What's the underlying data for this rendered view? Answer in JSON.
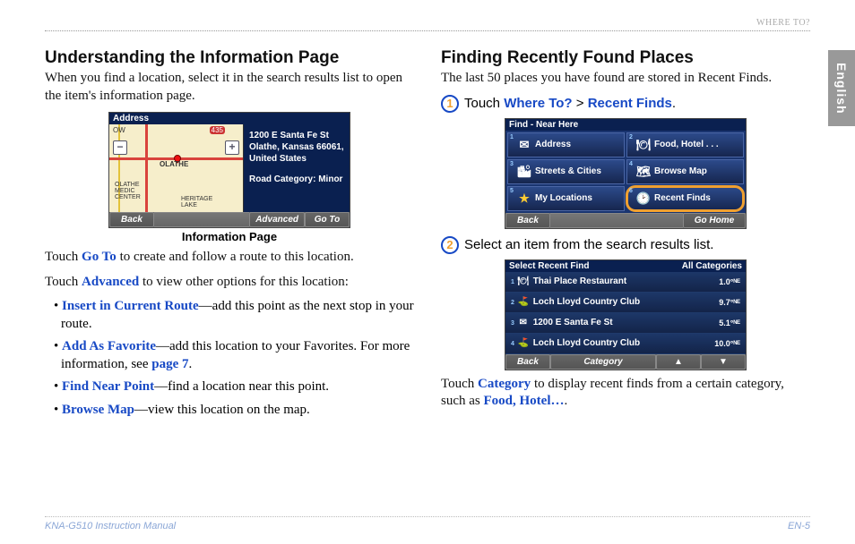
{
  "header": {
    "section": "WHERE TO?",
    "lang_tab": "English"
  },
  "col1": {
    "heading": "Understanding the Information Page",
    "intro": "When you find a location, select it in the search results list to open the item's information page.",
    "info_shot": {
      "title": "Address",
      "addr1": "1200 E Santa Fe St",
      "addr2": "Olathe, Kansas 66061,",
      "addr3": "United States",
      "road_cat": "Road Category: Minor",
      "back": "Back",
      "advanced": "Advanced",
      "goto": "Go To",
      "map_labels": {
        "ow": "OW",
        "olathe": "OLATHE",
        "medic": "OLATHE\nMEDIC\nCENTER",
        "lake": "HERITAGE\nLAKE",
        "hwy": "435"
      }
    },
    "caption": "Information Page",
    "p_goto_pre": "Touch ",
    "p_goto_link": "Go To",
    "p_goto_post": " to create and follow a route to this location.",
    "p_adv_pre": "Touch ",
    "p_adv_link": "Advanced",
    "p_adv_post": " to view other options for this location:",
    "opts": [
      {
        "b": "Insert in Current Route",
        "t": "—add this point as the next stop in your route."
      },
      {
        "b": "Add As Favorite",
        "t": "—add this location to your Favorites. For more information, see ",
        "pg": "page 7",
        "tail": "."
      },
      {
        "b": "Find Near Point",
        "t": "—find a location near this point."
      },
      {
        "b": "Browse Map",
        "t": "—view this location on the map."
      }
    ]
  },
  "col2": {
    "heading": "Finding Recently Found Places",
    "intro": "The last 50 places you have found are stored in Recent Finds.",
    "step1_pre": "Touch ",
    "step1_a": "Where To?",
    "step1_sep": " > ",
    "step1_b": "Recent Finds",
    "step1_post": ".",
    "find_shot": {
      "title": "Find - Near Here",
      "tiles": [
        {
          "n": "1",
          "icon": "✉",
          "label": "Address"
        },
        {
          "n": "2",
          "icon": "🍽",
          "label": "Food, Hotel . . ."
        },
        {
          "n": "3",
          "icon": "🏙",
          "label": "Streets & Cities"
        },
        {
          "n": "4",
          "icon": "🗺",
          "label": "Browse Map"
        },
        {
          "n": "5",
          "icon": "★",
          "label": "My Locations"
        },
        {
          "n": "6",
          "icon": "🕑",
          "label": "Recent Finds",
          "hl": true
        }
      ],
      "back": "Back",
      "gohome": "Go Home"
    },
    "step2": "Select an item from the search results list.",
    "recent_shot": {
      "h_left": "Select Recent Find",
      "h_right": "All Categories",
      "rows": [
        {
          "n": "1",
          "ic": "🍽",
          "name": "Thai Place Restaurant",
          "d": "1.0°ᴺᴱ"
        },
        {
          "n": "2",
          "ic": "⛳",
          "name": "Loch Lloyd Country Club",
          "d": "9.7°ᴺᴱ"
        },
        {
          "n": "3",
          "ic": "✉",
          "name": "1200 E Santa Fe St",
          "d": "5.1°ᴺᴱ"
        },
        {
          "n": "4",
          "ic": "⛳",
          "name": "Loch Lloyd Country Club",
          "d": "10.0°ᴺᴱ"
        }
      ],
      "back": "Back",
      "cat": "Category",
      "up": "▲",
      "down": "▼"
    },
    "p3_pre": "Touch ",
    "p3_link": "Category",
    "p3_mid": " to display recent finds from a certain category, such as ",
    "p3_link2": "Food, Hotel…",
    "p3_post": "."
  },
  "footer": {
    "left": "KNA-G510 Instruction Manual",
    "right": "EN-5"
  }
}
